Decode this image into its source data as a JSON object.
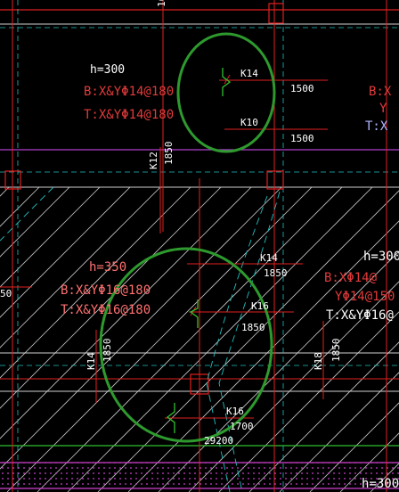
{
  "labels": {
    "slab_a": {
      "h": "h=300",
      "bottom": "B:X&YΦ14@180",
      "top": "T:X&YΦ14@180"
    },
    "slab_b": {
      "h": "h=350",
      "bottom": "B:X&YΦ16@180",
      "top": "T:X&YΦ16@180"
    },
    "right_top": {
      "bottom": "B:X",
      "y": "Y",
      "top": "T:X"
    },
    "right_mid": {
      "h": "h=300",
      "bottom": "B:XΦ14@",
      "y": "YΦ14@150",
      "top": "T:X&YΦ16@"
    },
    "rebars": {
      "k14_a": {
        "mark": "K14",
        "length": "1500"
      },
      "k10": {
        "mark": "K10",
        "length": "1500"
      },
      "k12": {
        "mark": "K12",
        "length": "1850"
      },
      "k14_b": {
        "mark": "K14",
        "length": "1850"
      },
      "k16_a": {
        "mark": "K16",
        "length": "1850"
      },
      "k16_b": {
        "mark": "K16",
        "length": "1700"
      },
      "k14_c": {
        "mark": "K14",
        "length": "1850"
      },
      "k18": {
        "mark": "K18",
        "length": "1850"
      }
    },
    "dimension": "29200",
    "left_edge": "50",
    "bottom_right": "h=300",
    "top_edge": "16"
  },
  "colors": {
    "background": "#000000",
    "grid_red": "#e02020",
    "dashed_cyan": "#20c0c0",
    "highlight_green": "#2e9a2e",
    "wall_magenta": "#d040d0"
  }
}
